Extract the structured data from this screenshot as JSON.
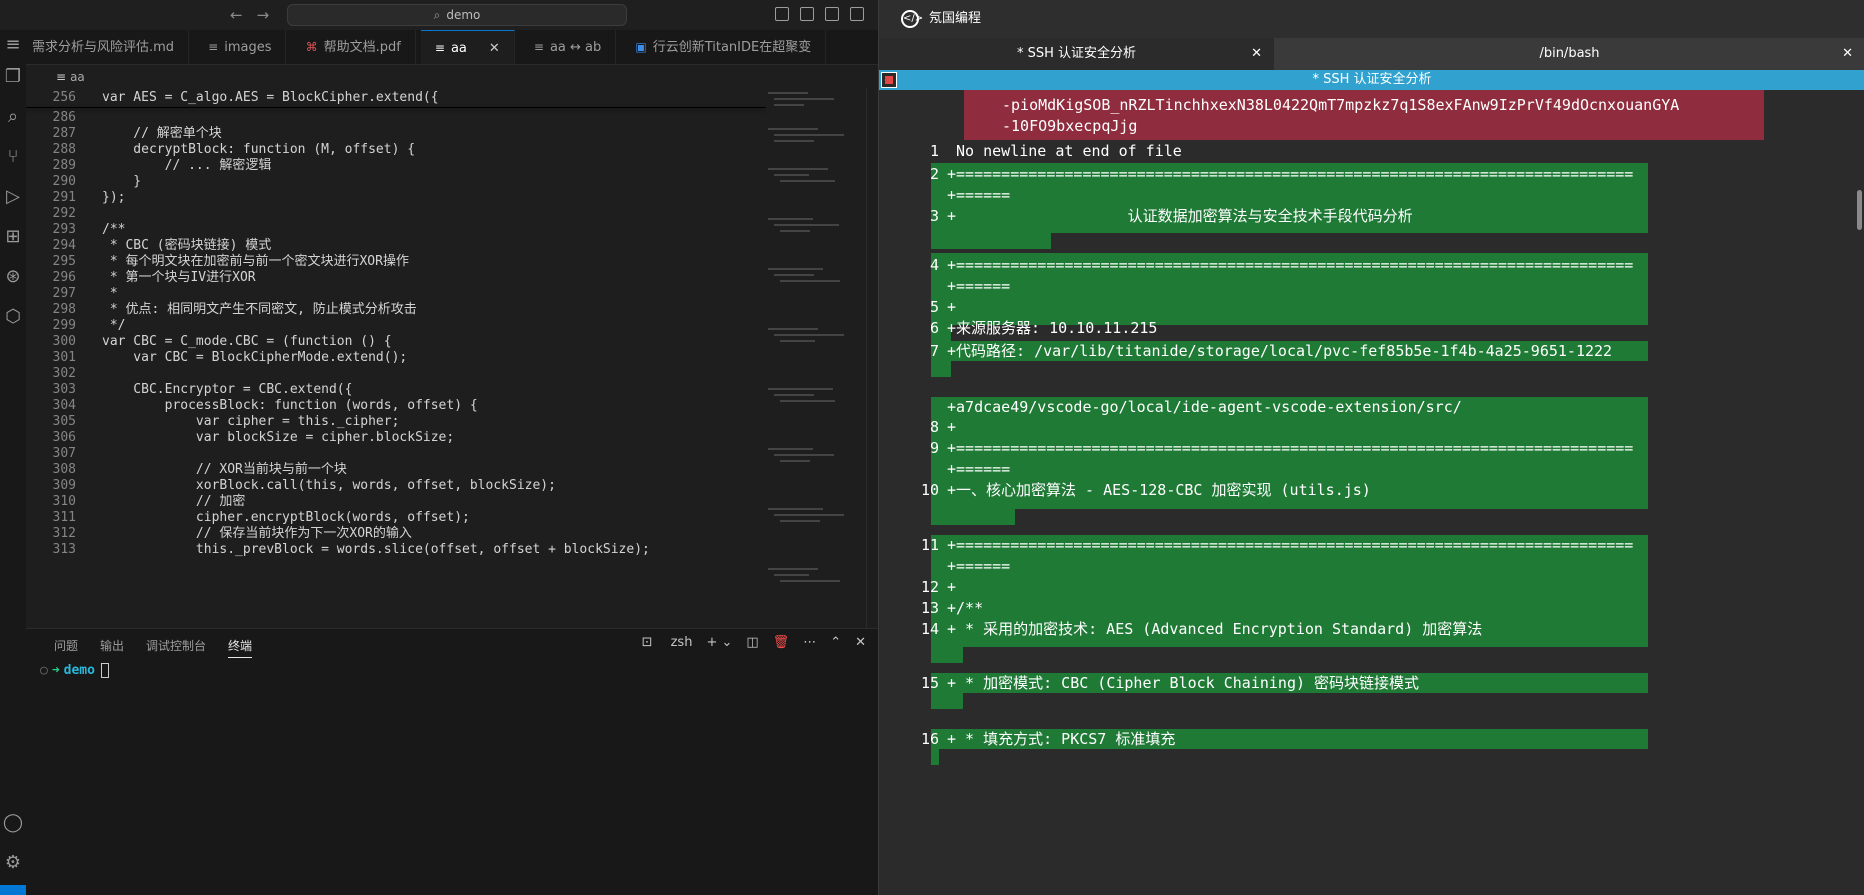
{
  "ide": {
    "title_search": "demo",
    "tabs": [
      {
        "label": "需求分析与风险评估.md",
        "icon": "markdown-icon"
      },
      {
        "label": "images",
        "icon": "file-icon"
      },
      {
        "label": "帮助文档.pdf",
        "icon": "pdf-icon"
      },
      {
        "label": "aa",
        "icon": "file-icon",
        "active": true
      },
      {
        "label": "aa ↔ ab",
        "icon": "diff-icon"
      },
      {
        "label": "行云创新TitanIDE在超聚变",
        "icon": "doc-icon"
      }
    ],
    "breadcrumb": "aa",
    "code": [
      {
        "n": "256",
        "t": "var AES = C_algo.AES = BlockCipher.extend({"
      },
      {
        "n": "286",
        "t": ""
      },
      {
        "n": "287",
        "t": "    // 解密单个块"
      },
      {
        "n": "288",
        "t": "    decryptBlock: function (M, offset) {"
      },
      {
        "n": "289",
        "t": "        // ... 解密逻辑"
      },
      {
        "n": "290",
        "t": "    }"
      },
      {
        "n": "291",
        "t": "});"
      },
      {
        "n": "292",
        "t": ""
      },
      {
        "n": "293",
        "t": "/**"
      },
      {
        "n": "294",
        "t": " * CBC (密码块链接) 模式"
      },
      {
        "n": "295",
        "t": " * 每个明文块在加密前与前一个密文块进行XOR操作"
      },
      {
        "n": "296",
        "t": " * 第一个块与IV进行XOR"
      },
      {
        "n": "297",
        "t": " *"
      },
      {
        "n": "298",
        "t": " * 优点: 相同明文产生不同密文, 防止模式分析攻击"
      },
      {
        "n": "299",
        "t": " */"
      },
      {
        "n": "300",
        "t": "var CBC = C_mode.CBC = (function () {"
      },
      {
        "n": "301",
        "t": "    var CBC = BlockCipherMode.extend();"
      },
      {
        "n": "302",
        "t": ""
      },
      {
        "n": "303",
        "t": "    CBC.Encryptor = CBC.extend({"
      },
      {
        "n": "304",
        "t": "        processBlock: function (words, offset) {"
      },
      {
        "n": "305",
        "t": "            var cipher = this._cipher;"
      },
      {
        "n": "306",
        "t": "            var blockSize = cipher.blockSize;"
      },
      {
        "n": "307",
        "t": ""
      },
      {
        "n": "308",
        "t": "            // XOR当前块与前一个块"
      },
      {
        "n": "309",
        "t": "            xorBlock.call(this, words, offset, blockSize);"
      },
      {
        "n": "310",
        "t": "            // 加密"
      },
      {
        "n": "311",
        "t": "            cipher.encryptBlock(words, offset);"
      },
      {
        "n": "312",
        "t": "            // 保存当前块作为下一次XOR的输入"
      },
      {
        "n": "313",
        "t": "            this._prevBlock = words.slice(offset, offset + blockSize);"
      }
    ],
    "panel_tabs": [
      "问题",
      "输出",
      "调试控制台",
      "终端"
    ],
    "shell": "zsh",
    "prompt_dir": "demo"
  },
  "term": {
    "app_title": "氖国编程",
    "tabs": [
      "* SSH 认证安全分析",
      "/bin/bash"
    ],
    "header": "* SSH 认证安全分析",
    "lines": [
      {
        "n": "",
        "t": "-pioMdKigSOB_nRZLTinchhxexN38L0422QmT7mpzkz7q1S8exFAnw9IzPrVf49dOcnxouanGYA"
      },
      {
        "n": "",
        "t": "-10FO9bxecpqJjg"
      },
      {
        "n": "1",
        "t": " No newline at end of file"
      },
      {
        "n": "2",
        "t": "+==========================================================================="
      },
      {
        "n": "",
        "t": "+======"
      },
      {
        "n": "3",
        "t": "+                   认证数据加密算法与安全技术手段代码分析"
      },
      {
        "n": "4",
        "t": "+==========================================================================="
      },
      {
        "n": "",
        "t": "+======"
      },
      {
        "n": "5",
        "t": "+"
      },
      {
        "n": "6",
        "t": "+来源服务器: 10.10.11.215"
      },
      {
        "n": "7",
        "t": "+代码路径: /var/lib/titanide/storage/local/pvc-fef85b5e-1f4b-4a25-9651-1222"
      },
      {
        "n": "",
        "t": "+a7dcae49/vscode-go/local/ide-agent-vscode-extension/src/"
      },
      {
        "n": "8",
        "t": "+"
      },
      {
        "n": "9",
        "t": "+==========================================================================="
      },
      {
        "n": "",
        "t": "+======"
      },
      {
        "n": "10",
        "t": "+一、核心加密算法 - AES-128-CBC 加密实现 (utils.js)"
      },
      {
        "n": "11",
        "t": "+==========================================================================="
      },
      {
        "n": "",
        "t": "+======"
      },
      {
        "n": "12",
        "t": "+"
      },
      {
        "n": "13",
        "t": "+/**"
      },
      {
        "n": "14",
        "t": "+ * 采用的加密技术: AES (Advanced Encryption Standard) 加密算法"
      },
      {
        "n": "15",
        "t": "+ * 加密模式: CBC (Cipher Block Chaining) 密码块链接模式"
      },
      {
        "n": "16",
        "t": "+ * 填充方式: PKCS7 标准填充"
      }
    ]
  },
  "colors": {
    "accent": "#0078d4",
    "term_header": "#31a2d0",
    "diff_removed": "#8f2d3f",
    "diff_added": "#1f7a36"
  }
}
